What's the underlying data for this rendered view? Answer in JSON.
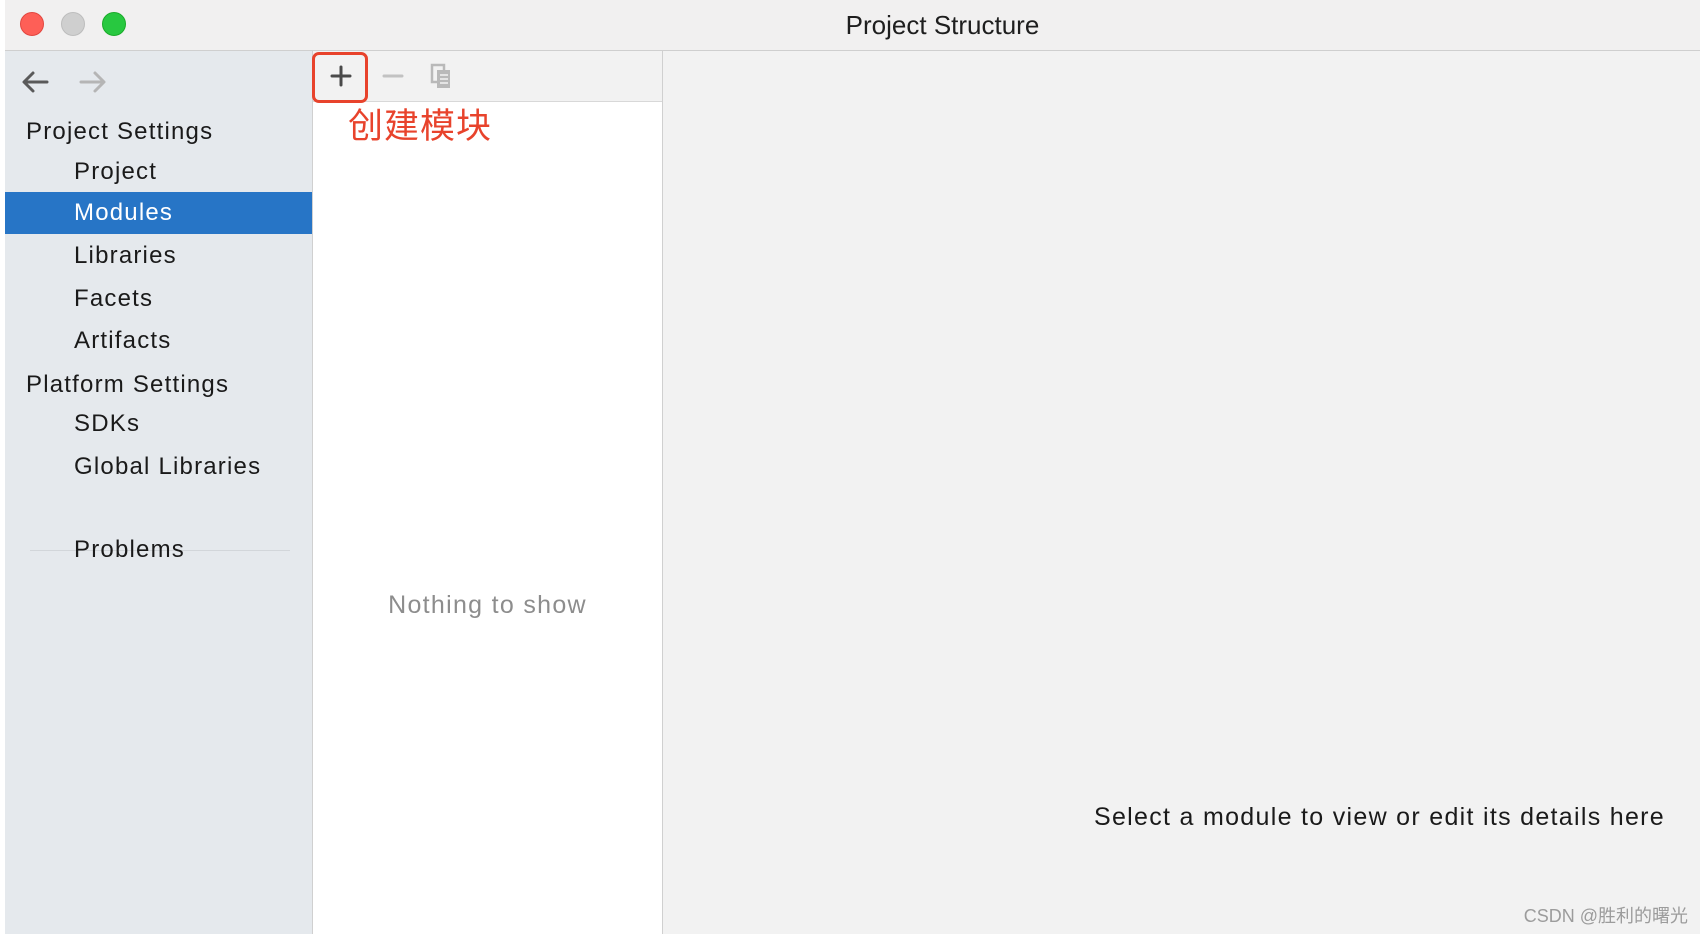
{
  "window": {
    "title": "Project Structure",
    "controls": [
      "close",
      "minimize",
      "maximize"
    ]
  },
  "sidebar": {
    "nav": {
      "back_icon": "arrow-left-icon",
      "forward_icon": "arrow-right-icon"
    },
    "sections": [
      {
        "label": "Project Settings"
      },
      {
        "label": "Platform Settings"
      }
    ],
    "items": [
      {
        "label": "Project",
        "selected": false
      },
      {
        "label": "Modules",
        "selected": true
      },
      {
        "label": "Libraries",
        "selected": false
      },
      {
        "label": "Facets",
        "selected": false
      },
      {
        "label": "Artifacts",
        "selected": false
      },
      {
        "label": "SDKs",
        "selected": false
      },
      {
        "label": "Global Libraries",
        "selected": false
      },
      {
        "label": "Problems",
        "selected": false
      }
    ]
  },
  "list_panel": {
    "toolbar": {
      "add_icon": "plus-icon",
      "remove_icon": "minus-icon",
      "copy_icon": "copy-icon"
    },
    "annotation": "创建模块",
    "empty_text": "Nothing to show"
  },
  "detail_panel": {
    "placeholder": "Select a module to view or edit its details here"
  },
  "watermark": "CSDN @胜利的曙光",
  "colors": {
    "selection": "#2775c6",
    "annotation": "#e8432c",
    "sidebar_bg": "#e5e9ed"
  }
}
